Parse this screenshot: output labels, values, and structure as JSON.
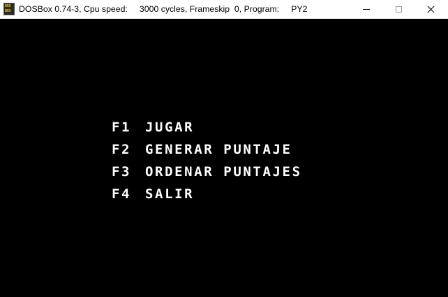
{
  "window": {
    "icon_text_top": "DOS",
    "icon_text_bottom": "BOX",
    "title": "DOSBox 0.74-3, Cpu speed:     3000 cycles, Frameskip  0, Program:     PY2",
    "buttons": {
      "minimize": "minimize",
      "maximize": "maximize",
      "close": "close"
    }
  },
  "menu": {
    "items": [
      {
        "key": "F1",
        "label": "JUGAR"
      },
      {
        "key": "F2",
        "label": "GENERAR PUNTAJE"
      },
      {
        "key": "F3",
        "label": "ORDENAR PUNTAJES"
      },
      {
        "key": "F4",
        "label": "SALIR"
      }
    ]
  },
  "colors": {
    "screen_background": "#000000",
    "text": "#ffffff",
    "titlebar": "#ffffff"
  }
}
